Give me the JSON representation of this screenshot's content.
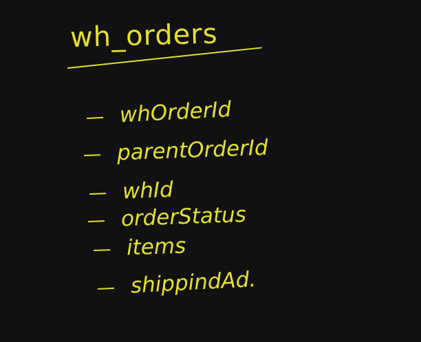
{
  "colors": {
    "background": "#111111",
    "ink": "#e2e22c"
  },
  "title": "wh_orders",
  "fields": [
    {
      "label": "whOrderId"
    },
    {
      "label": "parentOrderId"
    },
    {
      "label": "whId"
    },
    {
      "label": "orderStatus"
    },
    {
      "label": "items"
    },
    {
      "label": "shippindAd."
    }
  ]
}
